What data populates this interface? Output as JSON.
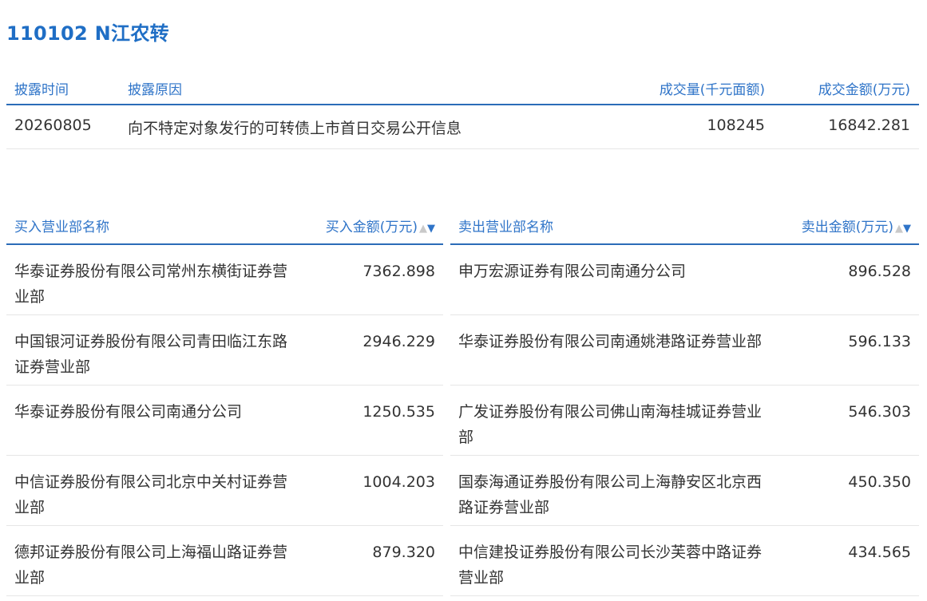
{
  "title": "110102 N江农转",
  "disclosure": {
    "headers": {
      "time": "披露时间",
      "reason": "披露原因",
      "volume": "成交量(千元面额)",
      "amount": "成交金额(万元)"
    },
    "row": {
      "time": "20260805",
      "reason": "向不特定对象发行的可转债上市首日交易公开信息",
      "volume": "108245",
      "amount": "16842.281"
    }
  },
  "buy": {
    "name_header": "买入营业部名称",
    "amount_header": "买入金额(万元)",
    "sort_up": "▲",
    "sort_down": "▼",
    "rows": [
      {
        "name": "华泰证券股份有限公司常州东横街证券营业部",
        "amount": "7362.898"
      },
      {
        "name": "中国银河证券股份有限公司青田临江东路证券营业部",
        "amount": "2946.229"
      },
      {
        "name": "华泰证券股份有限公司南通分公司",
        "amount": "1250.535"
      },
      {
        "name": "中信证券股份有限公司北京中关村证券营业部",
        "amount": "1004.203"
      },
      {
        "name": "德邦证券股份有限公司上海福山路证券营业部",
        "amount": "879.320"
      }
    ]
  },
  "sell": {
    "name_header": "卖出营业部名称",
    "amount_header": "卖出金额(万元)",
    "sort_up": "▲",
    "sort_down": "▼",
    "rows": [
      {
        "name": "申万宏源证券有限公司南通分公司",
        "amount": "896.528"
      },
      {
        "name": "华泰证券股份有限公司南通姚港路证券营业部",
        "amount": "596.133"
      },
      {
        "name": "广发证券股份有限公司佛山南海桂城证券营业部",
        "amount": "546.303"
      },
      {
        "name": "国泰海通证券股份有限公司上海静安区北京西路证券营业部",
        "amount": "450.350"
      },
      {
        "name": "中信建投证券股份有限公司长沙芙蓉中路证券营业部",
        "amount": "434.565"
      }
    ]
  },
  "colors": {
    "accent": "#2f74c8",
    "title": "#1f6ec5",
    "text": "#333333",
    "divider": "#e6e6e6",
    "sort_inactive": "#c9c9c9"
  }
}
